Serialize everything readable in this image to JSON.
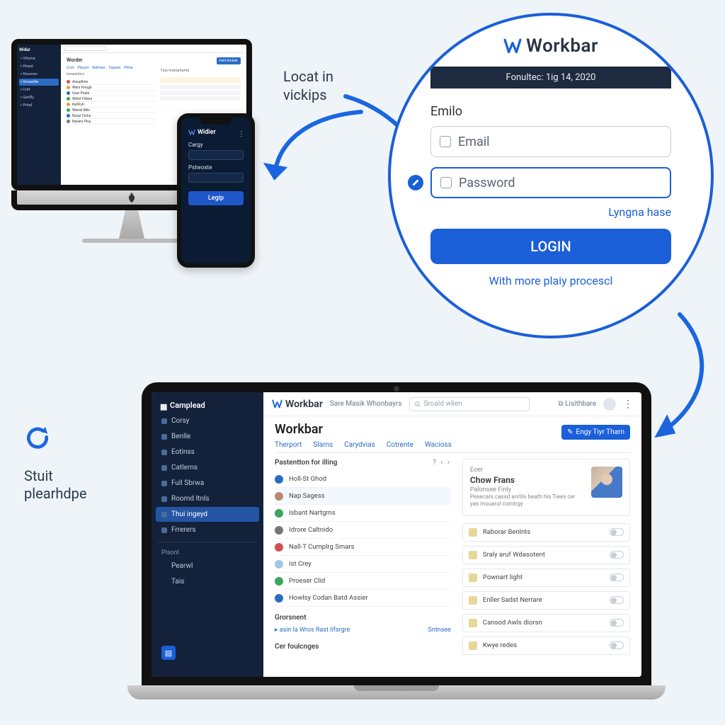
{
  "caption_top": "Locat in\nvickips",
  "refresh_caption": "Stuit\nplearhdpe",
  "login": {
    "brand": "Workbar",
    "datebar": "Fonultec: 1ig 14, 2020",
    "section_label": "Emilo",
    "email_placeholder": "Email",
    "password_placeholder": "Password",
    "forgot_link": "Lyngna hase",
    "button": "LOGIN",
    "footer": "With more plaiy procescl"
  },
  "iphone": {
    "brand": "Widier",
    "field1": "Cargy",
    "field2": "Pstwoste",
    "button": "Legip"
  },
  "imac": {
    "brand": "Widur",
    "title": "Worder",
    "tabs": [
      "Crist",
      "Phpaut",
      "Rabnser",
      "Capsen",
      "Phlse"
    ],
    "action_button": "Fent hminer",
    "section1_title": "Iwvesitors",
    "section2_title": "Tius Instriphante",
    "sidebar_items": [
      "Vitome",
      "Hirest",
      "Roumen",
      "Innsartte",
      "Cntt",
      "Getifly",
      "Pntaf"
    ],
    "sidebar_active_index": 3,
    "list": [
      {
        "color": "#d24e4e",
        "label": "Aisuptlirw"
      },
      {
        "color": "#e79b3a",
        "label": "Wers Flnogh"
      },
      {
        "color": "#2a6cc4",
        "label": "Usar Pnate"
      },
      {
        "color": "#3aa55d",
        "label": "Wihnt Fitters"
      },
      {
        "color": "#e79b3a",
        "label": "KerlFsh"
      },
      {
        "color": "#3aa55d",
        "label": "Werral Mitn"
      },
      {
        "color": "#2a6cc4",
        "label": "Bsnul Ciohs"
      },
      {
        "color": "#777",
        "label": "Nevers Plus"
      }
    ]
  },
  "macbook": {
    "brand": "Workbar",
    "breadcrumb": "Sare Masik Whonbayrs",
    "search_placeholder": "Sroald wlien",
    "top_icon_label": "Lisithbare",
    "title": "Workbar",
    "tabs": [
      "Therport",
      "Slams",
      "Carydvias",
      "Cotrente",
      "Wacioss"
    ],
    "action_button": "Engy Tiyr Tharn",
    "sidebar": {
      "header": "Camplead",
      "items": [
        "Corsy",
        "Benlle",
        "Eotinss",
        "Catlerns",
        "Full Sbrwa",
        "Roomd Itnls",
        "Thui ingeyd",
        "Frrerers"
      ],
      "active_index": 6,
      "group_label": "Pisonl",
      "group_items": [
        "Pearwl",
        "Tais"
      ]
    },
    "left_panel_title": "Pastentton for illing",
    "left_list": [
      {
        "color": "#2a6cc4",
        "label": "Holl-St Ghod"
      },
      {
        "color": "#b58b6a",
        "label": "Nap Sagess",
        "selected": true
      },
      {
        "color": "#3aa55d",
        "label": "Isbant Nartgms"
      },
      {
        "color": "#777",
        "label": "Idrore Caltnido"
      },
      {
        "color": "#d24e4e",
        "label": "Nall-T Cumplrg Smars"
      },
      {
        "color": "#9ec6e6",
        "label": "Ist Crey"
      },
      {
        "color": "#3aa55d",
        "label": "Proeser Clid"
      },
      {
        "color": "#2a6cc4",
        "label": "Howlsy Codan Batd Assier"
      }
    ],
    "subhead": "Grorsnent",
    "subrow_label": "asin la Wros Rast Iifsrgre",
    "subrow_action": "Sntnsee",
    "footer_label": "Cer foulcnges",
    "profile": {
      "eyebrow": "Eoer",
      "name": "Chow Frans",
      "role": "Palonsee Finly",
      "desc": "Pesecars cassd anrlils beath his Tiees cer yas mouarul comtrgy"
    },
    "right_items": [
      "Raborar Benlnts",
      "Sraly aruf Wdasotent",
      "Pownart light",
      "Enller Sadst Nerrare",
      "Cansod Awls diorsn",
      "Kwye redes"
    ]
  }
}
